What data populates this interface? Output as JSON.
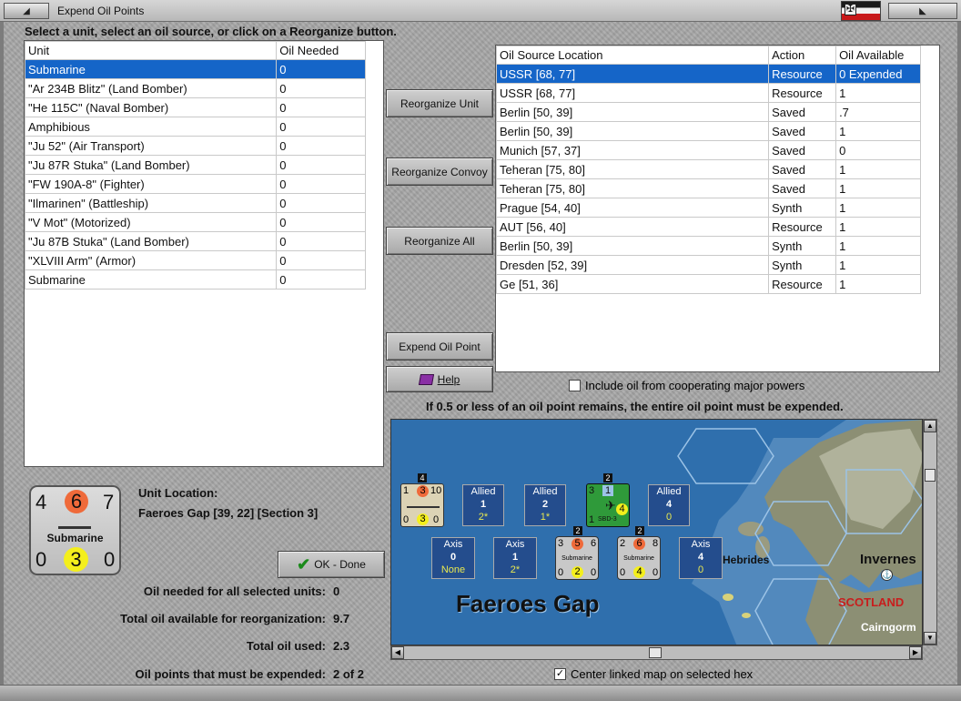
{
  "window": {
    "title": "Expend Oil Points"
  },
  "instruction": "Select a unit, select an oil source, or click on a Reorganize button.",
  "units_table": {
    "headers": [
      "Unit",
      "Oil Needed"
    ],
    "rows": [
      [
        "Submarine",
        "0"
      ],
      [
        "\"Ar 234B Blitz\" (Land Bomber)",
        "0"
      ],
      [
        "\"He 115C\" (Naval Bomber)",
        "0"
      ],
      [
        "Amphibious",
        "0"
      ],
      [
        "\"Ju 52\" (Air Transport)",
        "0"
      ],
      [
        "\"Ju 87R Stuka\" (Land Bomber)",
        "0"
      ],
      [
        "\"FW 190A-8\" (Fighter)",
        "0"
      ],
      [
        "\"Ilmarinen\" (Battleship)",
        "0"
      ],
      [
        "\"V Mot\" (Motorized)",
        "0"
      ],
      [
        "\"Ju 87B Stuka\" (Land Bomber)",
        "0"
      ],
      [
        "\"XLVIII Arm\" (Armor)",
        "0"
      ],
      [
        "Submarine",
        "0"
      ]
    ],
    "selected_index": 0
  },
  "sources_table": {
    "headers": [
      "Oil Source Location",
      "Action",
      "Oil Available"
    ],
    "rows": [
      [
        "USSR [68, 77]",
        "Resource",
        "0 Expended"
      ],
      [
        "USSR [68, 77]",
        "Resource",
        "1"
      ],
      [
        "Berlin [50, 39]",
        "Saved",
        ".7"
      ],
      [
        "Berlin [50, 39]",
        "Saved",
        "1"
      ],
      [
        "Munich [57, 37]",
        "Saved",
        "0"
      ],
      [
        "Teheran [75, 80]",
        "Saved",
        "1"
      ],
      [
        "Teheran [75, 80]",
        "Saved",
        "1"
      ],
      [
        "Prague [54, 40]",
        "Synth",
        "1"
      ],
      [
        "AUT [56, 40]",
        "Resource",
        "1"
      ],
      [
        "Berlin [50, 39]",
        "Synth",
        "1"
      ],
      [
        "Dresden [52, 39]",
        "Synth",
        "1"
      ],
      [
        "Ge [51, 36]",
        "Resource",
        "1"
      ]
    ],
    "selected_index": 0
  },
  "buttons": {
    "reorganize_unit": "Reorganize Unit",
    "reorganize_convoy": "Reorganize Convoy",
    "reorganize_all": "Reorganize All",
    "expend_oil_point": "Expend Oil Point",
    "help": "Help",
    "ok_done": "OK - Done"
  },
  "include_cooperating": {
    "label": "Include oil from cooperating major powers",
    "checked": false
  },
  "rule_note": "If 0.5 or less of an oil point remains, the entire oil point must be expended.",
  "unit_counter": {
    "attack": "4",
    "defense": "6",
    "move": "7",
    "name": "Submarine",
    "left": "0",
    "center": "3",
    "right": "0"
  },
  "unit_location": {
    "label": "Unit Location:",
    "value": "Faeroes Gap [39, 22] [Section 3]"
  },
  "summary": {
    "oil_needed_label": "Oil needed for all selected units:",
    "oil_needed": "0",
    "total_available_label": "Total oil available for reorganization:",
    "total_available": "9.7",
    "total_used_label": "Total oil used:",
    "total_used": "2.3",
    "must_expend_label": "Oil points that must be expended:",
    "must_expend": "2 of 2"
  },
  "map": {
    "sea_name": "Faeroes Gap",
    "labels": {
      "hebrides": "Hebrides",
      "inverness": "Invernes",
      "scotland": "SCOTLAND",
      "cairngorm": "Cairngorm"
    },
    "boxes": [
      {
        "side": "Allied",
        "num": "1",
        "sub": "2*"
      },
      {
        "side": "Allied",
        "num": "2",
        "sub": "1*"
      },
      {
        "side": "Allied",
        "num": "4",
        "sub": "0"
      },
      {
        "side": "Axis",
        "num": "0",
        "sub": "None"
      },
      {
        "side": "Axis",
        "num": "1",
        "sub": "2*"
      },
      {
        "side": "Axis",
        "num": "4",
        "sub": "0"
      }
    ],
    "stack_counts": [
      "4",
      "2",
      "2",
      "2"
    ],
    "counters": [
      {
        "a": "1",
        "d": "3",
        "m": "10",
        "b1": "0",
        "b2": "3",
        "b3": "0"
      },
      {
        "a": "3",
        "d": "1",
        "m": "",
        "b1": "1",
        "b2": "4",
        "b3": "",
        "label": "SBD-3"
      },
      {
        "a": "3",
        "d": "5",
        "m": "6",
        "name": "Submarine",
        "b1": "0",
        "b2": "2",
        "b3": "0"
      },
      {
        "a": "2",
        "d": "6",
        "m": "8",
        "name": "Submarine",
        "b1": "0",
        "b2": "4",
        "b3": "0"
      }
    ]
  },
  "center_linked": {
    "label": "Center linked map on selected hex",
    "checked": true
  },
  "colors": {
    "selection": "#1565c8",
    "sea": "#2f6fad",
    "orange": "#ef6a3a",
    "yellow": "#f4ef1c"
  }
}
